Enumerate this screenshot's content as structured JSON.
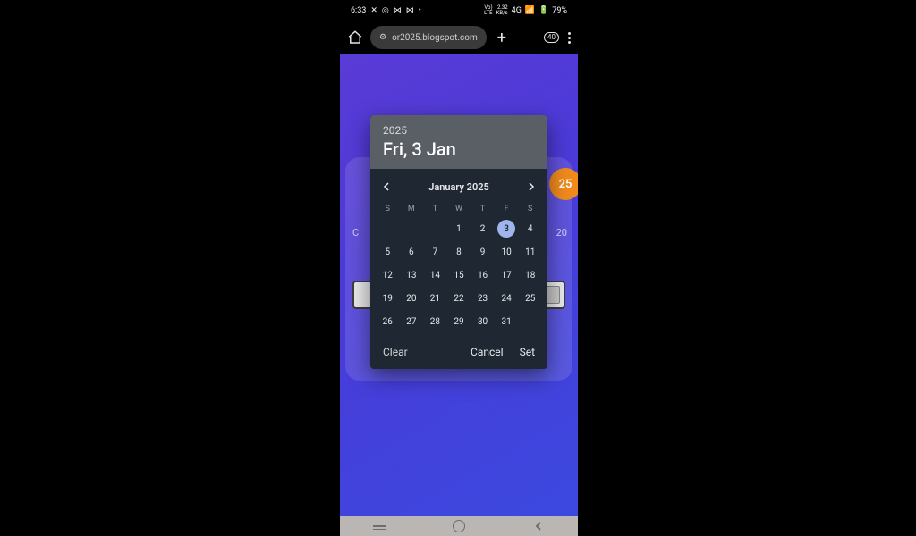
{
  "status": {
    "time": "6:33",
    "left_icons": [
      "✕",
      "◎",
      "⋈",
      "⋈",
      "•"
    ],
    "net_top": "2.32",
    "net_bot": "KB/s",
    "lte_top": "Vo)",
    "lte_bot": "LTE",
    "g": "4G",
    "signal": "▮",
    "battery_pct": "79%"
  },
  "chrome": {
    "url": "or2025.blogspot.com",
    "tab_count": "40"
  },
  "background": {
    "badge": "25",
    "label_left": "C",
    "label_right": "20"
  },
  "picker": {
    "year": "2025",
    "date_line": "Fri, 3 Jan",
    "month_label": "January 2025",
    "weekdays": [
      "S",
      "M",
      "T",
      "W",
      "T",
      "F",
      "S"
    ],
    "blanks": 3,
    "days": [
      1,
      2,
      3,
      4,
      5,
      6,
      7,
      8,
      9,
      10,
      11,
      12,
      13,
      14,
      15,
      16,
      17,
      18,
      19,
      20,
      21,
      22,
      23,
      24,
      25,
      26,
      27,
      28,
      29,
      30,
      31
    ],
    "selected_day": 3,
    "actions": {
      "clear": "Clear",
      "cancel": "Cancel",
      "set": "Set"
    }
  }
}
